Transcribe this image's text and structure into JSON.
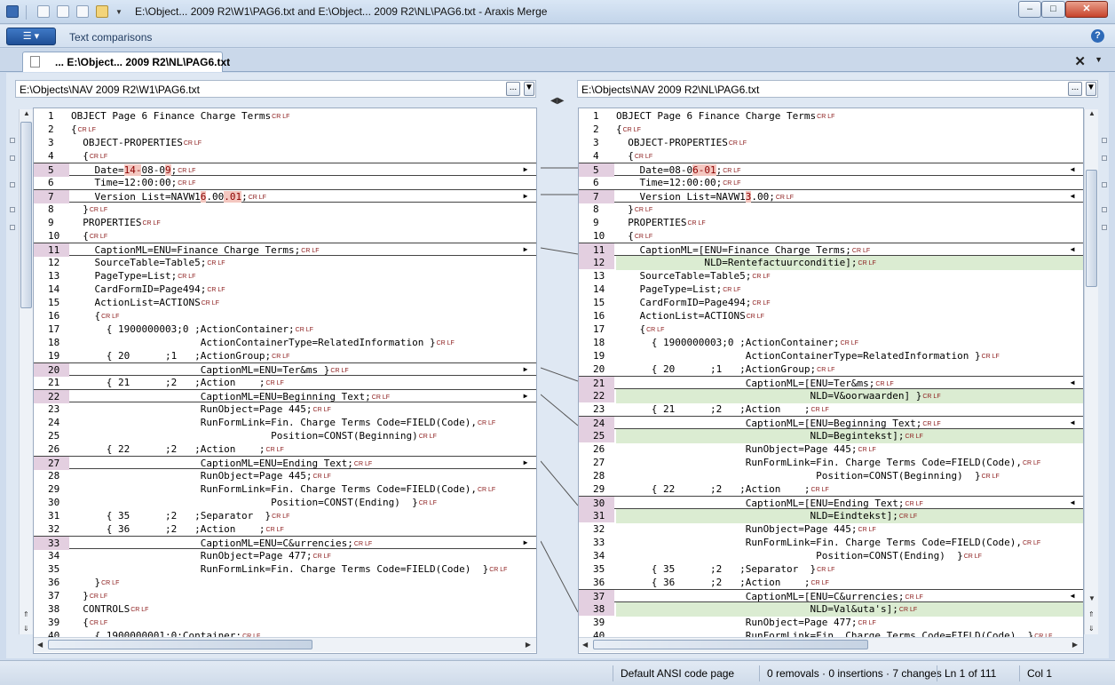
{
  "window": {
    "title": "E:\\Object... 2009 R2\\W1\\PAG6.txt and E:\\Object... 2009 R2\\NL\\PAG6.txt - Araxis Merge"
  },
  "ribbon": {
    "tab": "Text comparisons",
    "help": "?"
  },
  "doc_tab": {
    "label": "... E:\\Object... 2009 R2\\NL\\PAG6.txt",
    "close": "✕",
    "menu": "▼"
  },
  "left": {
    "path": "E:\\Objects\\NAV 2009 R2\\W1\\PAG6.txt",
    "lines": [
      {
        "n": "1",
        "t": "OBJECT Page 6 Finance Charge Terms",
        "k": ""
      },
      {
        "n": "2",
        "t": "{",
        "k": ""
      },
      {
        "n": "3",
        "t": "  OBJECT-PROPERTIES",
        "k": ""
      },
      {
        "n": "4",
        "t": "  {",
        "k": ""
      },
      {
        "n": "5",
        "t": "    Date=",
        "h": "14-",
        "h2": "08-0",
        "h3": "9",
        "tail": ";",
        "k": "chg"
      },
      {
        "n": "6",
        "t": "    Time=12:00:00;",
        "k": ""
      },
      {
        "n": "7",
        "t": "    Version List=NAVW1",
        "h": "6",
        "h2": ".00",
        "h3": ".01",
        "tail": ";",
        "k": "chg"
      },
      {
        "n": "8",
        "t": "  }",
        "k": ""
      },
      {
        "n": "9",
        "t": "  PROPERTIES",
        "k": ""
      },
      {
        "n": "10",
        "t": "  {",
        "k": ""
      },
      {
        "n": "11",
        "t": "    CaptionML=ENU=Finance Charge Terms;",
        "k": "chg"
      },
      {
        "n": "12",
        "t": "    SourceTable=Table5;",
        "k": ""
      },
      {
        "n": "13",
        "t": "    PageType=List;",
        "k": ""
      },
      {
        "n": "14",
        "t": "    CardFormID=Page494;",
        "k": ""
      },
      {
        "n": "15",
        "t": "    ActionList=ACTIONS",
        "k": ""
      },
      {
        "n": "16",
        "t": "    {",
        "k": ""
      },
      {
        "n": "17",
        "t": "      { 1900000003;0 ;ActionContainer;",
        "k": ""
      },
      {
        "n": "18",
        "t": "                      ActionContainerType=RelatedInformation }",
        "k": ""
      },
      {
        "n": "19",
        "t": "      { 20      ;1   ;ActionGroup;",
        "k": ""
      },
      {
        "n": "20",
        "t": "                      CaptionML=ENU=Ter&ms }",
        "k": "chg"
      },
      {
        "n": "21",
        "t": "      { 21      ;2   ;Action    ;",
        "k": ""
      },
      {
        "n": "22",
        "t": "                      CaptionML=ENU=Beginning Text;",
        "k": "chg"
      },
      {
        "n": "23",
        "t": "                      RunObject=Page 445;",
        "k": ""
      },
      {
        "n": "24",
        "t": "                      RunFormLink=Fin. Charge Terms Code=FIELD(Code),",
        "k": ""
      },
      {
        "n": "25",
        "t": "                                  Position=CONST(Beginning)",
        "k": ""
      },
      {
        "n": "26",
        "t": "      { 22      ;2   ;Action    ;",
        "k": ""
      },
      {
        "n": "27",
        "t": "                      CaptionML=ENU=Ending Text;",
        "k": "chg"
      },
      {
        "n": "28",
        "t": "                      RunObject=Page 445;",
        "k": ""
      },
      {
        "n": "29",
        "t": "                      RunFormLink=Fin. Charge Terms Code=FIELD(Code),",
        "k": ""
      },
      {
        "n": "30",
        "t": "                                  Position=CONST(Ending)  }",
        "k": ""
      },
      {
        "n": "31",
        "t": "      { 35      ;2   ;Separator  }",
        "k": ""
      },
      {
        "n": "32",
        "t": "      { 36      ;2   ;Action    ;",
        "k": ""
      },
      {
        "n": "33",
        "t": "                      CaptionML=ENU=C&urrencies;",
        "k": "chg"
      },
      {
        "n": "34",
        "t": "                      RunObject=Page 477;",
        "k": ""
      },
      {
        "n": "35",
        "t": "                      RunFormLink=Fin. Charge Terms Code=FIELD(Code)  }",
        "k": ""
      },
      {
        "n": "36",
        "t": "    }",
        "k": ""
      },
      {
        "n": "37",
        "t": "  }",
        "k": ""
      },
      {
        "n": "38",
        "t": "  CONTROLS",
        "k": ""
      },
      {
        "n": "39",
        "t": "  {",
        "k": ""
      },
      {
        "n": "40",
        "t": "    { 1900000001;0;Container;",
        "k": ""
      }
    ]
  },
  "right": {
    "path": "E:\\Objects\\NAV 2009 R2\\NL\\PAG6.txt",
    "lines": [
      {
        "n": "1",
        "t": "OBJECT Page 6 Finance Charge Terms",
        "k": ""
      },
      {
        "n": "2",
        "t": "{",
        "k": ""
      },
      {
        "n": "3",
        "t": "  OBJECT-PROPERTIES",
        "k": ""
      },
      {
        "n": "4",
        "t": "  {",
        "k": ""
      },
      {
        "n": "5",
        "t": "    Date=08-0",
        "h": "6-01",
        "tail": ";",
        "k": "chg"
      },
      {
        "n": "6",
        "t": "    Time=12:00:00;",
        "k": ""
      },
      {
        "n": "7",
        "t": "    Version List=NAVW1",
        "h": "3",
        "tail": ".00;",
        "k": "chg"
      },
      {
        "n": "8",
        "t": "  }",
        "k": ""
      },
      {
        "n": "9",
        "t": "  PROPERTIES",
        "k": ""
      },
      {
        "n": "10",
        "t": "  {",
        "k": ""
      },
      {
        "n": "11",
        "t": "    CaptionML=[ENU=Finance Charge Terms;",
        "k": "chg"
      },
      {
        "n": "12",
        "t": "               NLD=Rentefactuurconditie];",
        "k": "ins"
      },
      {
        "n": "13",
        "t": "    SourceTable=Table5;",
        "k": ""
      },
      {
        "n": "14",
        "t": "    PageType=List;",
        "k": ""
      },
      {
        "n": "15",
        "t": "    CardFormID=Page494;",
        "k": ""
      },
      {
        "n": "16",
        "t": "    ActionList=ACTIONS",
        "k": ""
      },
      {
        "n": "17",
        "t": "    {",
        "k": ""
      },
      {
        "n": "18",
        "t": "      { 1900000003;0 ;ActionContainer;",
        "k": ""
      },
      {
        "n": "19",
        "t": "                      ActionContainerType=RelatedInformation }",
        "k": ""
      },
      {
        "n": "20",
        "t": "      { 20      ;1   ;ActionGroup;",
        "k": ""
      },
      {
        "n": "21",
        "t": "                      CaptionML=[ENU=Ter&ms;",
        "k": "chg"
      },
      {
        "n": "22",
        "t": "                                 NLD=V&oorwaarden] }",
        "k": "ins"
      },
      {
        "n": "23",
        "t": "      { 21      ;2   ;Action    ;",
        "k": ""
      },
      {
        "n": "24",
        "t": "                      CaptionML=[ENU=Beginning Text;",
        "k": "chg"
      },
      {
        "n": "25",
        "t": "                                 NLD=Begintekst];",
        "k": "ins"
      },
      {
        "n": "26",
        "t": "                      RunObject=Page 445;",
        "k": ""
      },
      {
        "n": "27",
        "t": "                      RunFormLink=Fin. Charge Terms Code=FIELD(Code),",
        "k": ""
      },
      {
        "n": "28",
        "t": "                                  Position=CONST(Beginning)  }",
        "k": ""
      },
      {
        "n": "29",
        "t": "      { 22      ;2   ;Action    ;",
        "k": ""
      },
      {
        "n": "30",
        "t": "                      CaptionML=[ENU=Ending Text;",
        "k": "chg"
      },
      {
        "n": "31",
        "t": "                                 NLD=Eindtekst];",
        "k": "ins"
      },
      {
        "n": "32",
        "t": "                      RunObject=Page 445;",
        "k": ""
      },
      {
        "n": "33",
        "t": "                      RunFormLink=Fin. Charge Terms Code=FIELD(Code),",
        "k": ""
      },
      {
        "n": "34",
        "t": "                                  Position=CONST(Ending)  }",
        "k": ""
      },
      {
        "n": "35",
        "t": "      { 35      ;2   ;Separator  }",
        "k": ""
      },
      {
        "n": "36",
        "t": "      { 36      ;2   ;Action    ;",
        "k": ""
      },
      {
        "n": "37",
        "t": "                      CaptionML=[ENU=C&urrencies;",
        "k": "chg"
      },
      {
        "n": "38",
        "t": "                                 NLD=Val&uta's];",
        "k": "ins"
      },
      {
        "n": "39",
        "t": "                      RunObject=Page 477;",
        "k": ""
      },
      {
        "n": "40",
        "t": "                      RunFormLink=Fin. Charge Terms Code=FIELD(Code)  }",
        "k": ""
      }
    ]
  },
  "crlf_marker": "CR LF",
  "status": {
    "codepage": "Default ANSI code page",
    "changes": "0 removals · 0 insertions · 7 changes",
    "line": "Ln 1 of 111",
    "col": "Col 1"
  },
  "colors": {
    "changed_line_number": "#e3cfe0",
    "inserted_text": "#dbecd2",
    "highlight": "#f4c7c0"
  }
}
